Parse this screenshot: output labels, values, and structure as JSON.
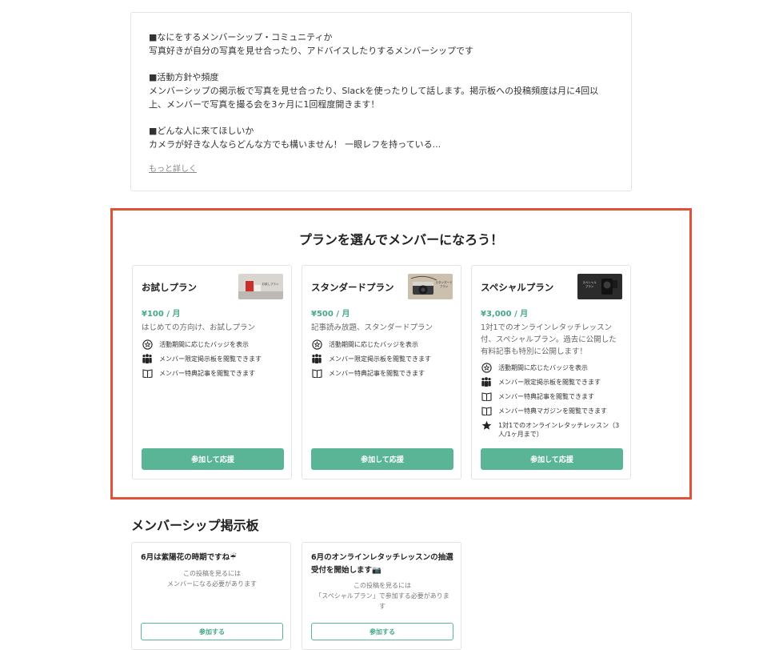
{
  "description": {
    "lines": [
      "■なにをするメンバーシップ・コミュニティか",
      "写真好きが自分の写真を見せ合ったり、アドバイスしたりするメンバーシップです",
      "",
      "■活動方針や頻度",
      "メンバーシップの掲示板で写真を見せ合ったり、Slackを使ったりして話します。掲示板への投稿頻度は月に4回以",
      "上、メンバーで写真を撮る会を3ヶ月に1回程度開きます！",
      "",
      "■どんな人に来てほしいか",
      "カメラが好きな人ならどんな方でも構いません！ 一眼レフを持っている..."
    ],
    "more_link": "もっと詳しく"
  },
  "plans_section": {
    "title": "プランを選んでメンバーになろう！",
    "accent_color": "#e0533a",
    "button_color": "#5ab597",
    "plans": [
      {
        "name": "お試しプラン",
        "thumb_text": "お試しプラン",
        "price": "¥100 / 月",
        "description": [
          "はじめての方向け、お試しプラン"
        ],
        "benefits": [
          {
            "icon": "badge-icon",
            "text": "活動期間に応じたバッジを表示"
          },
          {
            "icon": "members-icon",
            "text": "メンバー限定掲示板を閲覧できます"
          },
          {
            "icon": "book-icon",
            "text": "メンバー特典記事を閲覧できます"
          }
        ],
        "button": "参加して応援"
      },
      {
        "name": "スタンダードプラン",
        "thumb_text": "スタンダードプラン",
        "price": "¥500 / 月",
        "description": [
          "記事読み放題、スタンダードプラン"
        ],
        "benefits": [
          {
            "icon": "badge-icon",
            "text": "活動期間に応じたバッジを表示"
          },
          {
            "icon": "members-icon",
            "text": "メンバー限定掲示板を閲覧できます"
          },
          {
            "icon": "book-icon",
            "text": "メンバー特典記事を閲覧できます"
          }
        ],
        "button": "参加して応援"
      },
      {
        "name": "スペシャルプラン",
        "thumb_text": "スペシャルプラン",
        "price": "¥3,000 / 月",
        "description": [
          "1対1でのオンラインレタッチレッスン",
          "付、スペシャルプラン。過去に公開した",
          "有料記事も特別に公開します！"
        ],
        "benefits": [
          {
            "icon": "badge-icon",
            "text": "活動期間に応じたバッジを表示"
          },
          {
            "icon": "members-icon",
            "text": "メンバー限定掲示板を閲覧できます"
          },
          {
            "icon": "book-icon",
            "text": "メンバー特典記事を閲覧できます"
          },
          {
            "icon": "book-icon",
            "text": "メンバー特典マガジンを閲覧できます"
          },
          {
            "icon": "star-icon",
            "text": "1対1でのオンラインレタッチレッスン（3人/1ヶ月まで）"
          }
        ],
        "button": "参加して応援"
      }
    ]
  },
  "board": {
    "title": "メンバーシップ掲示板",
    "posts": [
      {
        "title": "6月は紫陽花の時期ですね☔",
        "lock_lines": [
          "この投稿を見るには",
          "メンバーになる必要があります"
        ],
        "button": "参加する"
      },
      {
        "title": "6月のオンラインレタッチレッスンの抽選受付を開始します📷",
        "lock_lines": [
          "この投稿を見るには",
          "「スペシャルプラン」で参加する必要がありま",
          "す"
        ],
        "button": "参加する"
      }
    ]
  }
}
